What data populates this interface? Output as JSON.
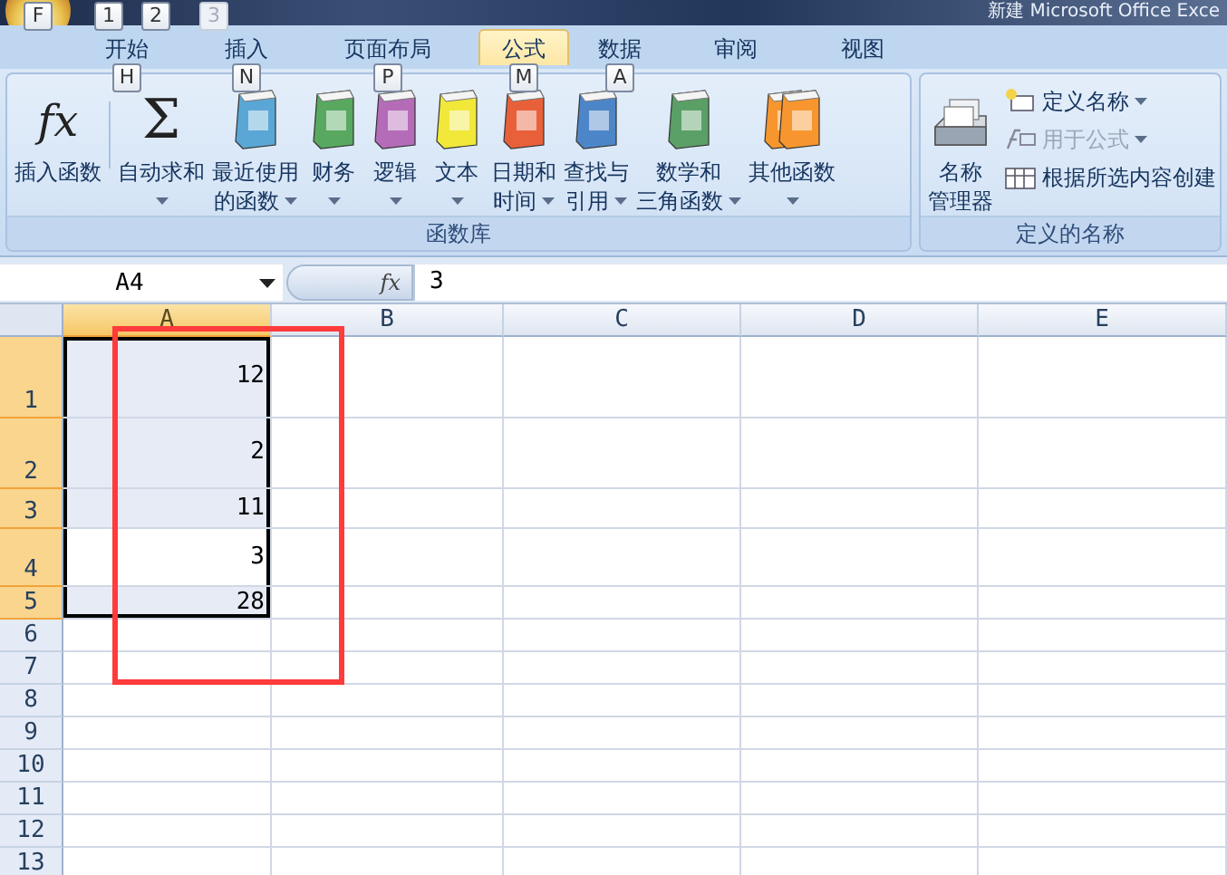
{
  "window": {
    "title": "新建 Microsoft Office Exce"
  },
  "office_key_tips": [
    {
      "label": "F",
      "disabled": false
    },
    {
      "label": "1",
      "disabled": false
    },
    {
      "label": "2",
      "disabled": false
    },
    {
      "label": "3",
      "disabled": true
    }
  ],
  "tabs": [
    {
      "label": "开始",
      "selected": false,
      "key_tip": "H"
    },
    {
      "label": "插入",
      "selected": false,
      "key_tip": "N"
    },
    {
      "label": "页面布局",
      "selected": false,
      "key_tip": "P"
    },
    {
      "label": "公式",
      "selected": true,
      "key_tip": "M"
    },
    {
      "label": "数据",
      "selected": false,
      "key_tip": "A"
    },
    {
      "label": "审阅",
      "selected": false
    },
    {
      "label": "视图",
      "selected": false
    }
  ],
  "ribbon_groups": [
    {
      "title": "函数库",
      "buttons": [
        {
          "kind": "glyph",
          "glyph": "fx",
          "label": [
            "插入函数"
          ],
          "dropdown": false
        },
        {
          "kind": "separator"
        },
        {
          "kind": "glyph",
          "glyph": "Σ",
          "label": [
            "自动求和"
          ],
          "dropdown": true
        },
        {
          "kind": "book",
          "color": "#5aa7d6",
          "label": [
            "最近使用",
            "的函数"
          ],
          "dropdown": true
        },
        {
          "kind": "book",
          "color": "#58a860",
          "label": [
            "财务"
          ],
          "dropdown": true
        },
        {
          "kind": "book",
          "color": "#b46cb8",
          "label": [
            "逻辑"
          ],
          "dropdown": true
        },
        {
          "kind": "book",
          "color": "#f2e83a",
          "label": [
            "文本"
          ],
          "dropdown": true
        },
        {
          "kind": "book",
          "color": "#e8603a",
          "label": [
            "日期和",
            "时间"
          ],
          "dropdown": true
        },
        {
          "kind": "book",
          "color": "#4d86c8",
          "label": [
            "查找与",
            "引用"
          ],
          "dropdown": true
        },
        {
          "kind": "book",
          "color": "#5aa066",
          "label": [
            "数学和",
            "三角函数"
          ],
          "dropdown": true
        },
        {
          "kind": "books",
          "color": "#f7962e",
          "label": [
            "其他函数"
          ],
          "dropdown": true
        }
      ]
    },
    {
      "title": "定义的名称",
      "buttons": [
        {
          "kind": "card-file",
          "label": [
            "名称",
            "管理器"
          ],
          "dropdown": false
        }
      ],
      "small_items": [
        {
          "label": "定义名称",
          "dropdown": true,
          "disabled": false
        },
        {
          "label": "用于公式",
          "dropdown": true,
          "disabled": true
        },
        {
          "label": "根据所选内容创建",
          "dropdown": false,
          "disabled": false
        }
      ]
    }
  ],
  "formula_bar": {
    "name_box": "A4",
    "fx": "fx",
    "value": "3"
  },
  "sheet": {
    "columns": [
      {
        "label": "A",
        "selected": true
      },
      {
        "label": "B",
        "selected": false
      },
      {
        "label": "C",
        "selected": false
      },
      {
        "label": "D",
        "selected": false
      },
      {
        "label": "E",
        "selected": false
      }
    ],
    "rows": [
      {
        "label": "1",
        "selected": true,
        "active": false,
        "value": "12"
      },
      {
        "label": "2",
        "selected": true,
        "active": false,
        "value": "2"
      },
      {
        "label": "3",
        "selected": true,
        "active": false,
        "value": "11"
      },
      {
        "label": "4",
        "selected": true,
        "active": true,
        "value": "3"
      },
      {
        "label": "5",
        "selected": true,
        "active": false,
        "value": "28"
      },
      {
        "label": "6",
        "selected": false,
        "active": false
      },
      {
        "label": "7",
        "selected": false,
        "active": false
      },
      {
        "label": "8",
        "selected": false,
        "active": false
      },
      {
        "label": "9",
        "selected": false,
        "active": false
      },
      {
        "label": "10",
        "selected": false,
        "active": false
      },
      {
        "label": "11",
        "selected": false,
        "active": false
      },
      {
        "label": "12",
        "selected": false,
        "active": false
      },
      {
        "label": "13",
        "selected": false,
        "active": false
      }
    ],
    "annotations": [
      {
        "kind": "rectangle"
      }
    ]
  }
}
